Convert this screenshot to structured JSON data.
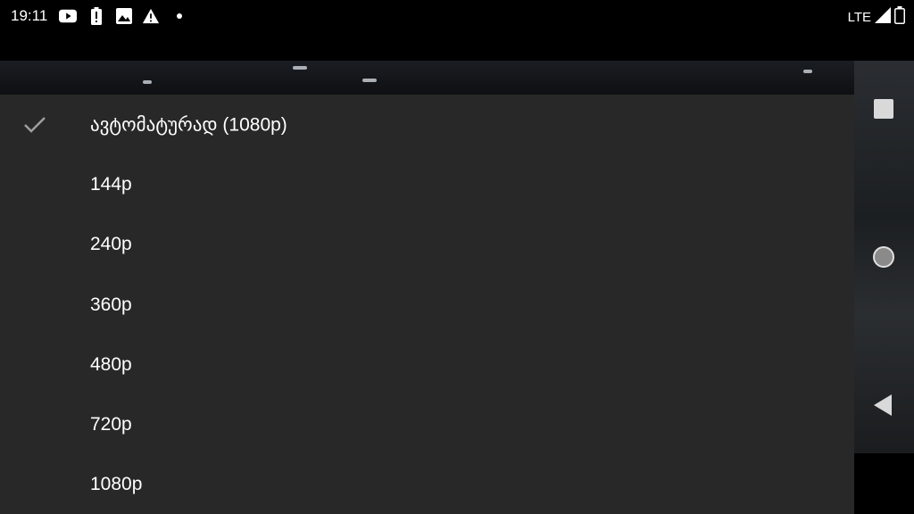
{
  "status_bar": {
    "time": "19:11",
    "icons_left": [
      "youtube-icon",
      "battery-alert-icon",
      "image-icon",
      "warning-icon",
      "dot-icon"
    ],
    "network": "LTE",
    "icons_right": [
      "signal-icon",
      "battery-icon"
    ]
  },
  "quality_menu": {
    "selected_index": 0,
    "options": [
      {
        "label": "ავტომატურად (1080p)",
        "selected": true
      },
      {
        "label": "144p",
        "selected": false
      },
      {
        "label": "240p",
        "selected": false
      },
      {
        "label": "360p",
        "selected": false
      },
      {
        "label": "480p",
        "selected": false
      },
      {
        "label": "720p",
        "selected": false
      },
      {
        "label": "1080p",
        "selected": false
      }
    ]
  },
  "nav_buttons": [
    "recents-icon",
    "home-icon",
    "back-icon"
  ],
  "colors": {
    "sheet_background": "#282828",
    "text": "#ffffff",
    "check": "#9e9e9e"
  }
}
